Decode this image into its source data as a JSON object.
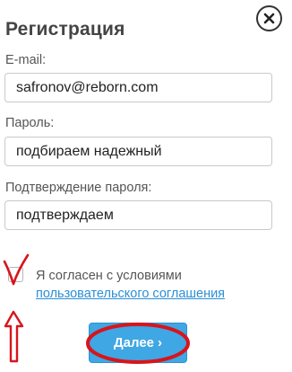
{
  "dialog": {
    "title": "Регистрация",
    "close_icon": "close-icon"
  },
  "form": {
    "email": {
      "label": "E-mail:",
      "value": "safronov@reborn.com"
    },
    "password": {
      "label": "Пароль:",
      "value": "подбираем надежный"
    },
    "password_confirm": {
      "label": "Подтверждение пароля:",
      "value": "подтверждаем"
    }
  },
  "agreement": {
    "checked": false,
    "text": "Я согласен с условиями",
    "link_text": "пользовательского соглашения"
  },
  "submit": {
    "label": "Далее",
    "icon": "chevron-right-icon"
  },
  "annotations": {
    "color": "#d8141c",
    "items": [
      "checkmark-annotation",
      "up-arrow-annotation",
      "button-circle-annotation"
    ]
  }
}
